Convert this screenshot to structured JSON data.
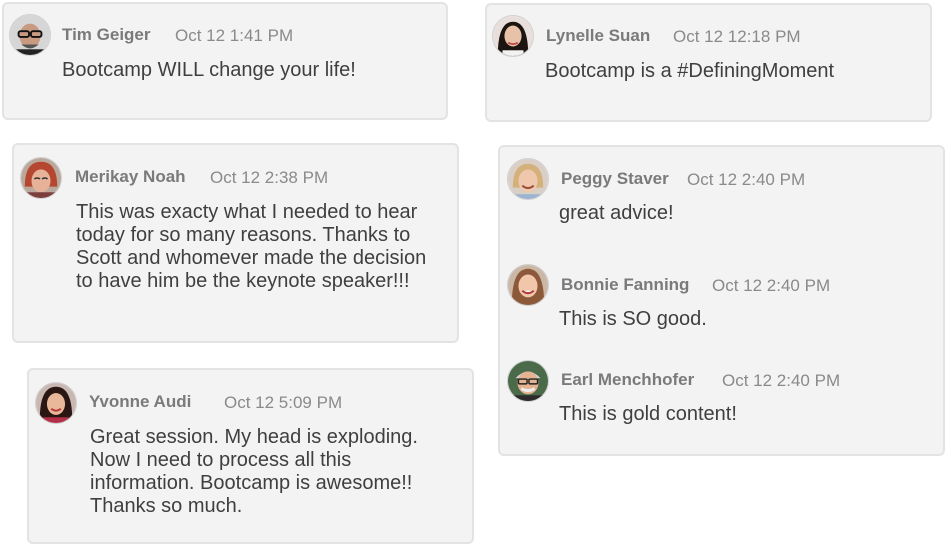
{
  "comments": [
    {
      "author": "Tim Geiger",
      "time": "Oct 12 1:41 PM",
      "text": "Bootcamp WILL change your life!",
      "avatar": "avatar-tim-geiger"
    },
    {
      "author": "Lynelle Suan",
      "time": "Oct 12 12:18 PM",
      "text": "Bootcamp is a #DefiningMoment",
      "avatar": "avatar-lynelle-suan"
    },
    {
      "author": "Merikay Noah",
      "time": "Oct 12 2:38 PM",
      "text": "This was exacty what I needed to hear today for so many reasons. Thanks to Scott and whomever made the decision to have him be the keynote speaker!!!",
      "avatar": "avatar-merikay-noah"
    },
    {
      "author": "Peggy Staver",
      "time": "Oct 12 2:40 PM",
      "text": "great advice!",
      "avatar": "avatar-peggy-staver"
    },
    {
      "author": "Bonnie Fanning",
      "time": "Oct 12 2:40 PM",
      "text": "This is SO good.",
      "avatar": "avatar-bonnie-fanning"
    },
    {
      "author": "Earl Menchhofer",
      "time": "Oct 12 2:40 PM",
      "text": "This is gold content!",
      "avatar": "avatar-earl-menchhofer"
    },
    {
      "author": "Yvonne Audi",
      "time": "Oct 12 5:09 PM",
      "text": "Great session. My head is exploding. Now I need to process all this information. Bootcamp is awesome!! Thanks so much.",
      "avatar": "avatar-yvonne-audi"
    }
  ],
  "colors": {
    "card_background": "#f3f3f3",
    "card_border": "#e3e3e3",
    "author_text": "#7a7a7a",
    "time_text": "#8a8a8a",
    "body_text": "#3f3f3f"
  }
}
